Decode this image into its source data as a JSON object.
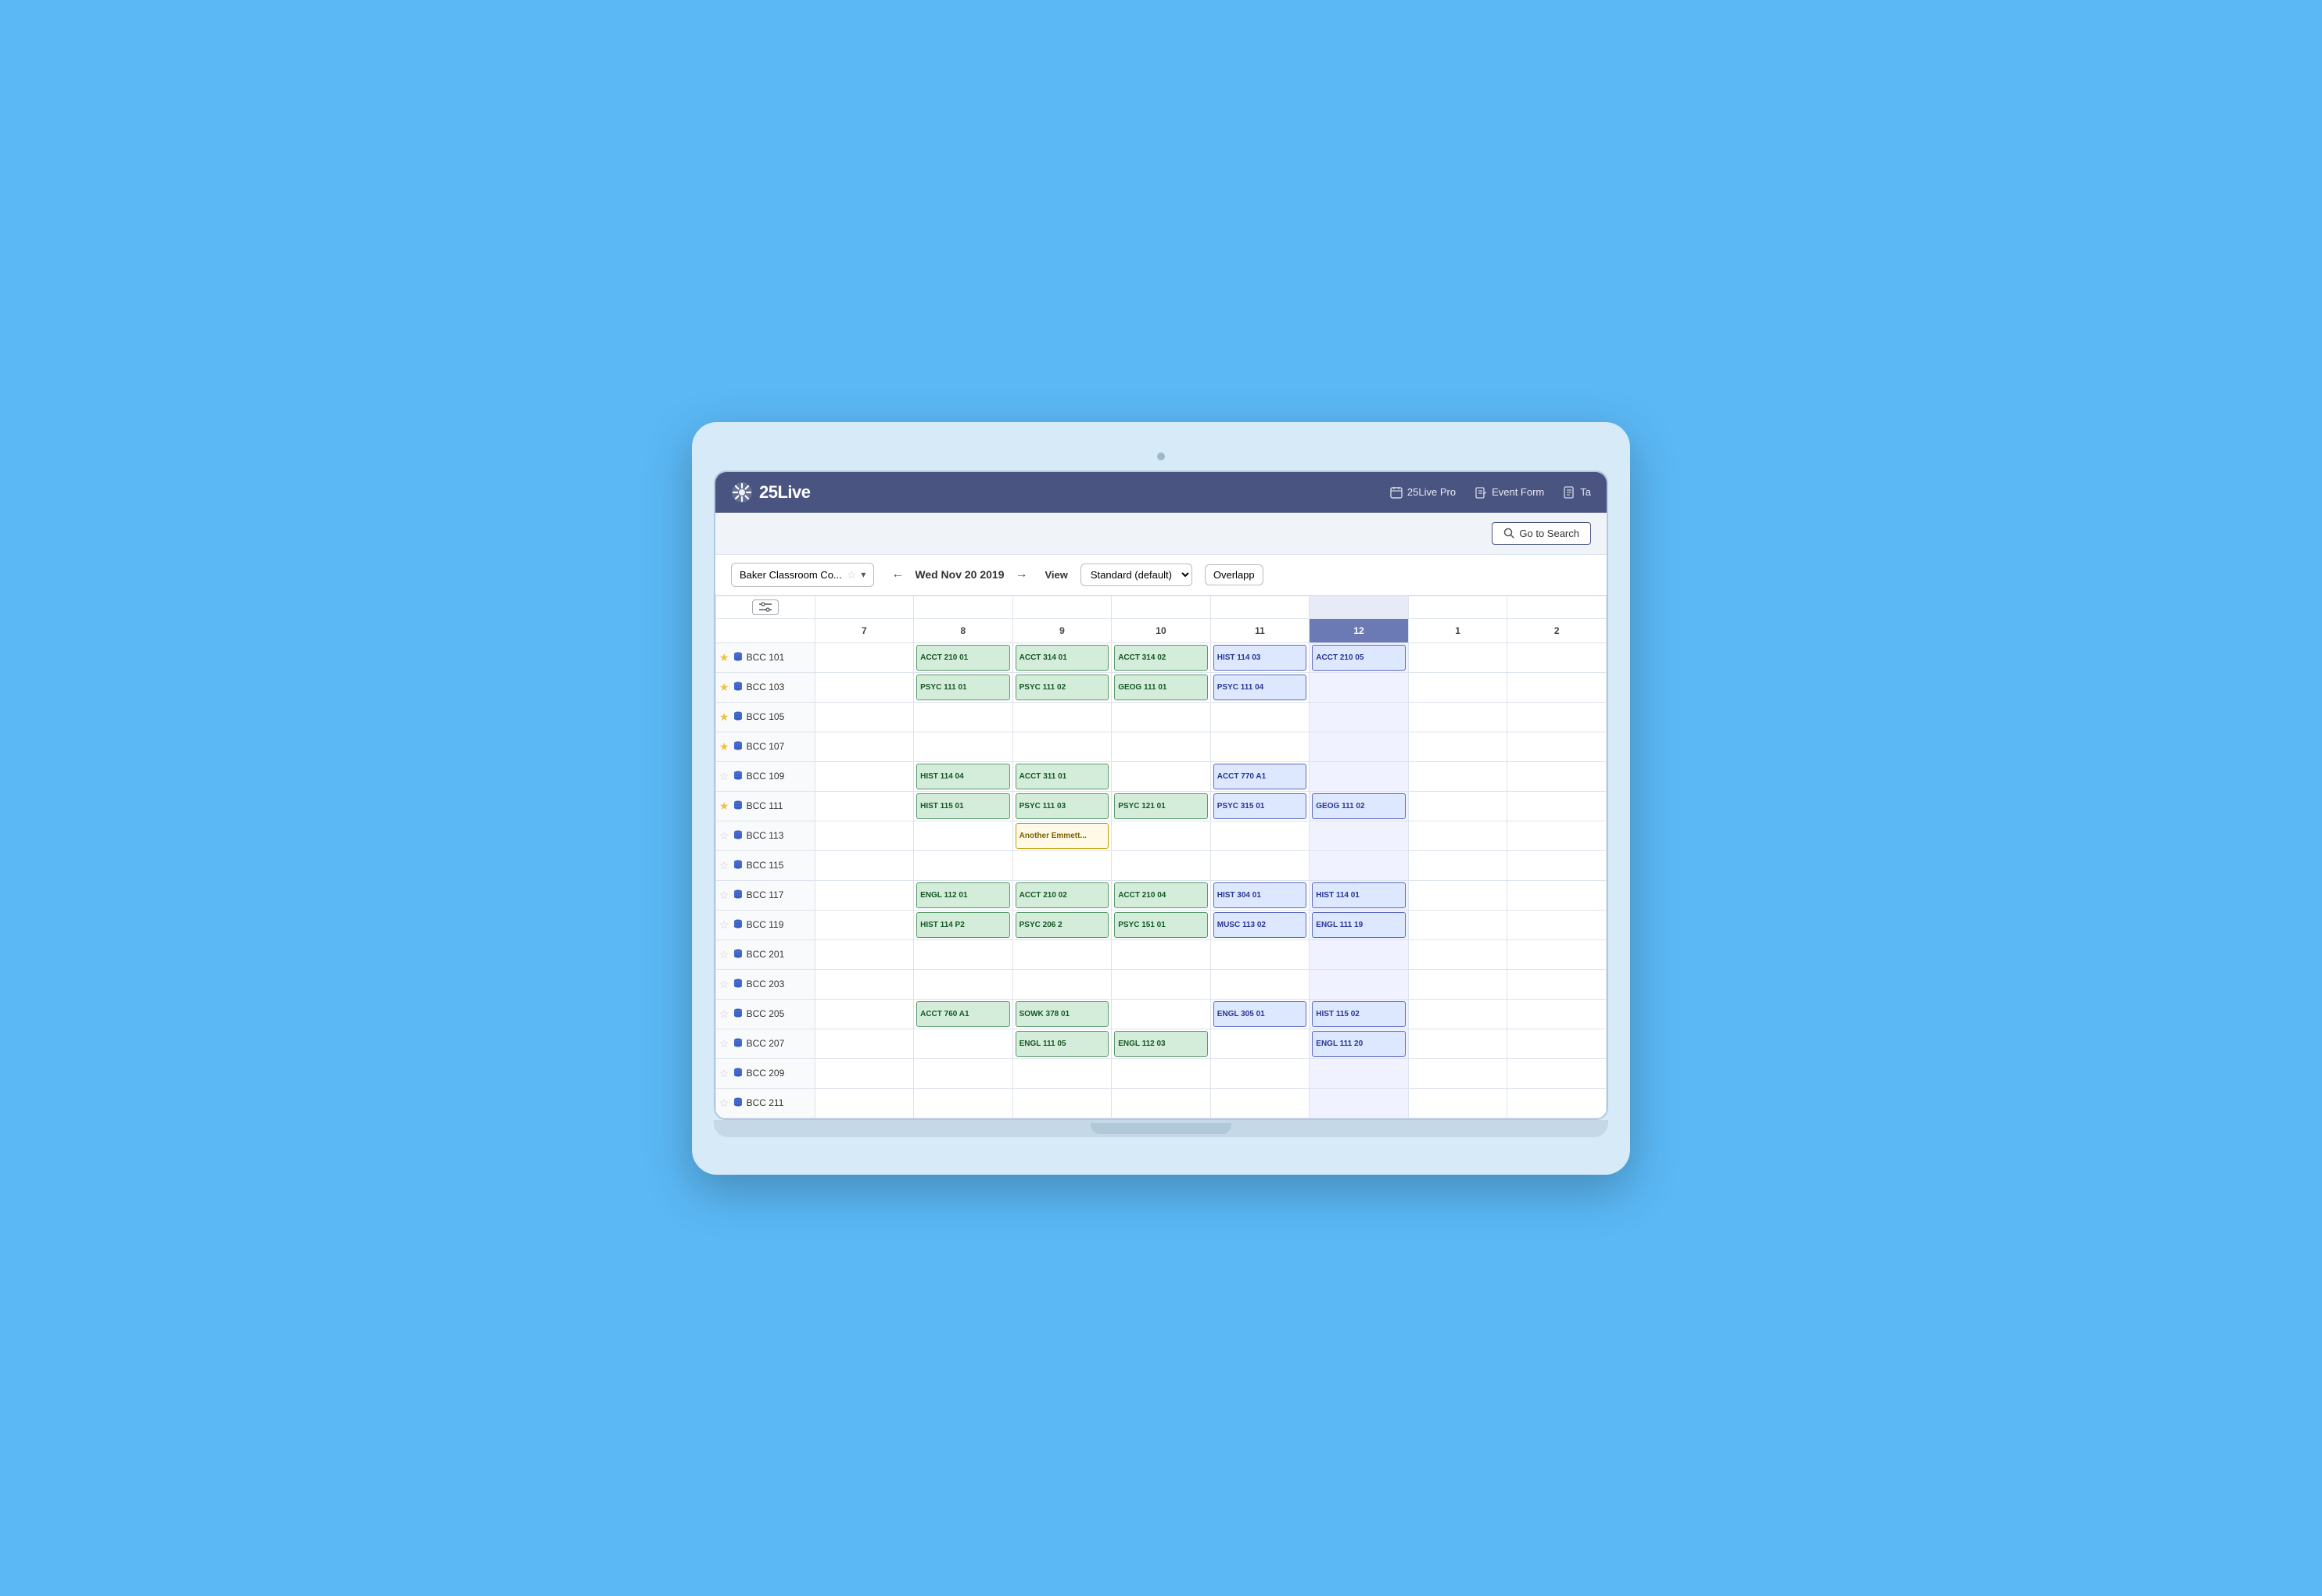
{
  "laptop": {
    "camera_alt": "camera"
  },
  "header": {
    "logo_text": "25Live",
    "nav_items": [
      {
        "id": "pro",
        "label": "25Live Pro",
        "icon": "calendar"
      },
      {
        "id": "form",
        "label": "Event Form",
        "icon": "edit"
      },
      {
        "id": "ta",
        "label": "Ta",
        "icon": "doc"
      }
    ]
  },
  "toolbar": {
    "go_search_label": "Go to Search"
  },
  "controls": {
    "room_name": "Baker Classroom Co...",
    "date": "Wed Nov 20 2019",
    "view_label": "View",
    "view_value": "Standard (default)",
    "overlap_label": "Overlapp"
  },
  "calendar": {
    "hours": [
      "7",
      "8",
      "9",
      "10",
      "11",
      "12",
      "1",
      "2"
    ],
    "highlighted_col": 5,
    "rooms": [
      {
        "name": "BCC 101",
        "star": true,
        "events": {
          "8": "ACCT 210 01",
          "9": "ACCT 314 01",
          "10": "ACCT 314 02",
          "11": "HIST 114 03",
          "12": "ACCT 210 05"
        }
      },
      {
        "name": "BCC 103",
        "star": true,
        "events": {
          "8": "PSYC 111 01",
          "9": "PSYC 111 02",
          "10": "GEOG 111 01",
          "11": "PSYC 111 04"
        }
      },
      {
        "name": "BCC 105",
        "star": true,
        "events": {}
      },
      {
        "name": "BCC 107",
        "star": true,
        "events": {}
      },
      {
        "name": "BCC 109",
        "star": false,
        "events": {
          "8": "HIST 114 04",
          "9": "ACCT 311 01",
          "11": "ACCT 770 A1"
        }
      },
      {
        "name": "BCC 111",
        "star": true,
        "events": {
          "8": "HIST 115 01",
          "9": "PSYC 111 03",
          "10": "PSYC 121 01",
          "11": "PSYC 315 01",
          "12": "GEOG 111 02"
        }
      },
      {
        "name": "BCC 113",
        "star": false,
        "events": {
          "9": "Another Emmett..."
        }
      },
      {
        "name": "BCC 115",
        "star": false,
        "events": {}
      },
      {
        "name": "BCC 117",
        "star": false,
        "events": {
          "8": "ENGL 112 01",
          "9": "ACCT 210 02",
          "10": "ACCT 210 04",
          "11": "HIST 304 01",
          "12": "HIST 114 01"
        }
      },
      {
        "name": "BCC 119",
        "star": false,
        "events": {
          "8": "HIST 114 P2",
          "9": "PSYC 206 2",
          "10": "PSYC 151 01",
          "11": "MUSC 113 02",
          "12": "ENGL 111 19"
        }
      },
      {
        "name": "BCC 201",
        "star": false,
        "events": {}
      },
      {
        "name": "BCC 203",
        "star": false,
        "events": {}
      },
      {
        "name": "BCC 205",
        "star": false,
        "events": {
          "8": "ACCT 760 A1",
          "9": "SOWK 378 01",
          "11": "ENGL 305 01",
          "12": "HIST 115 02"
        }
      },
      {
        "name": "BCC 207",
        "star": false,
        "events": {
          "9": "ENGL 111 05",
          "10": "ENGL 112 03",
          "12": "ENGL 111 20"
        }
      },
      {
        "name": "BCC 209",
        "star": false,
        "events": {}
      },
      {
        "name": "BCC 211",
        "star": false,
        "events": {}
      }
    ]
  }
}
